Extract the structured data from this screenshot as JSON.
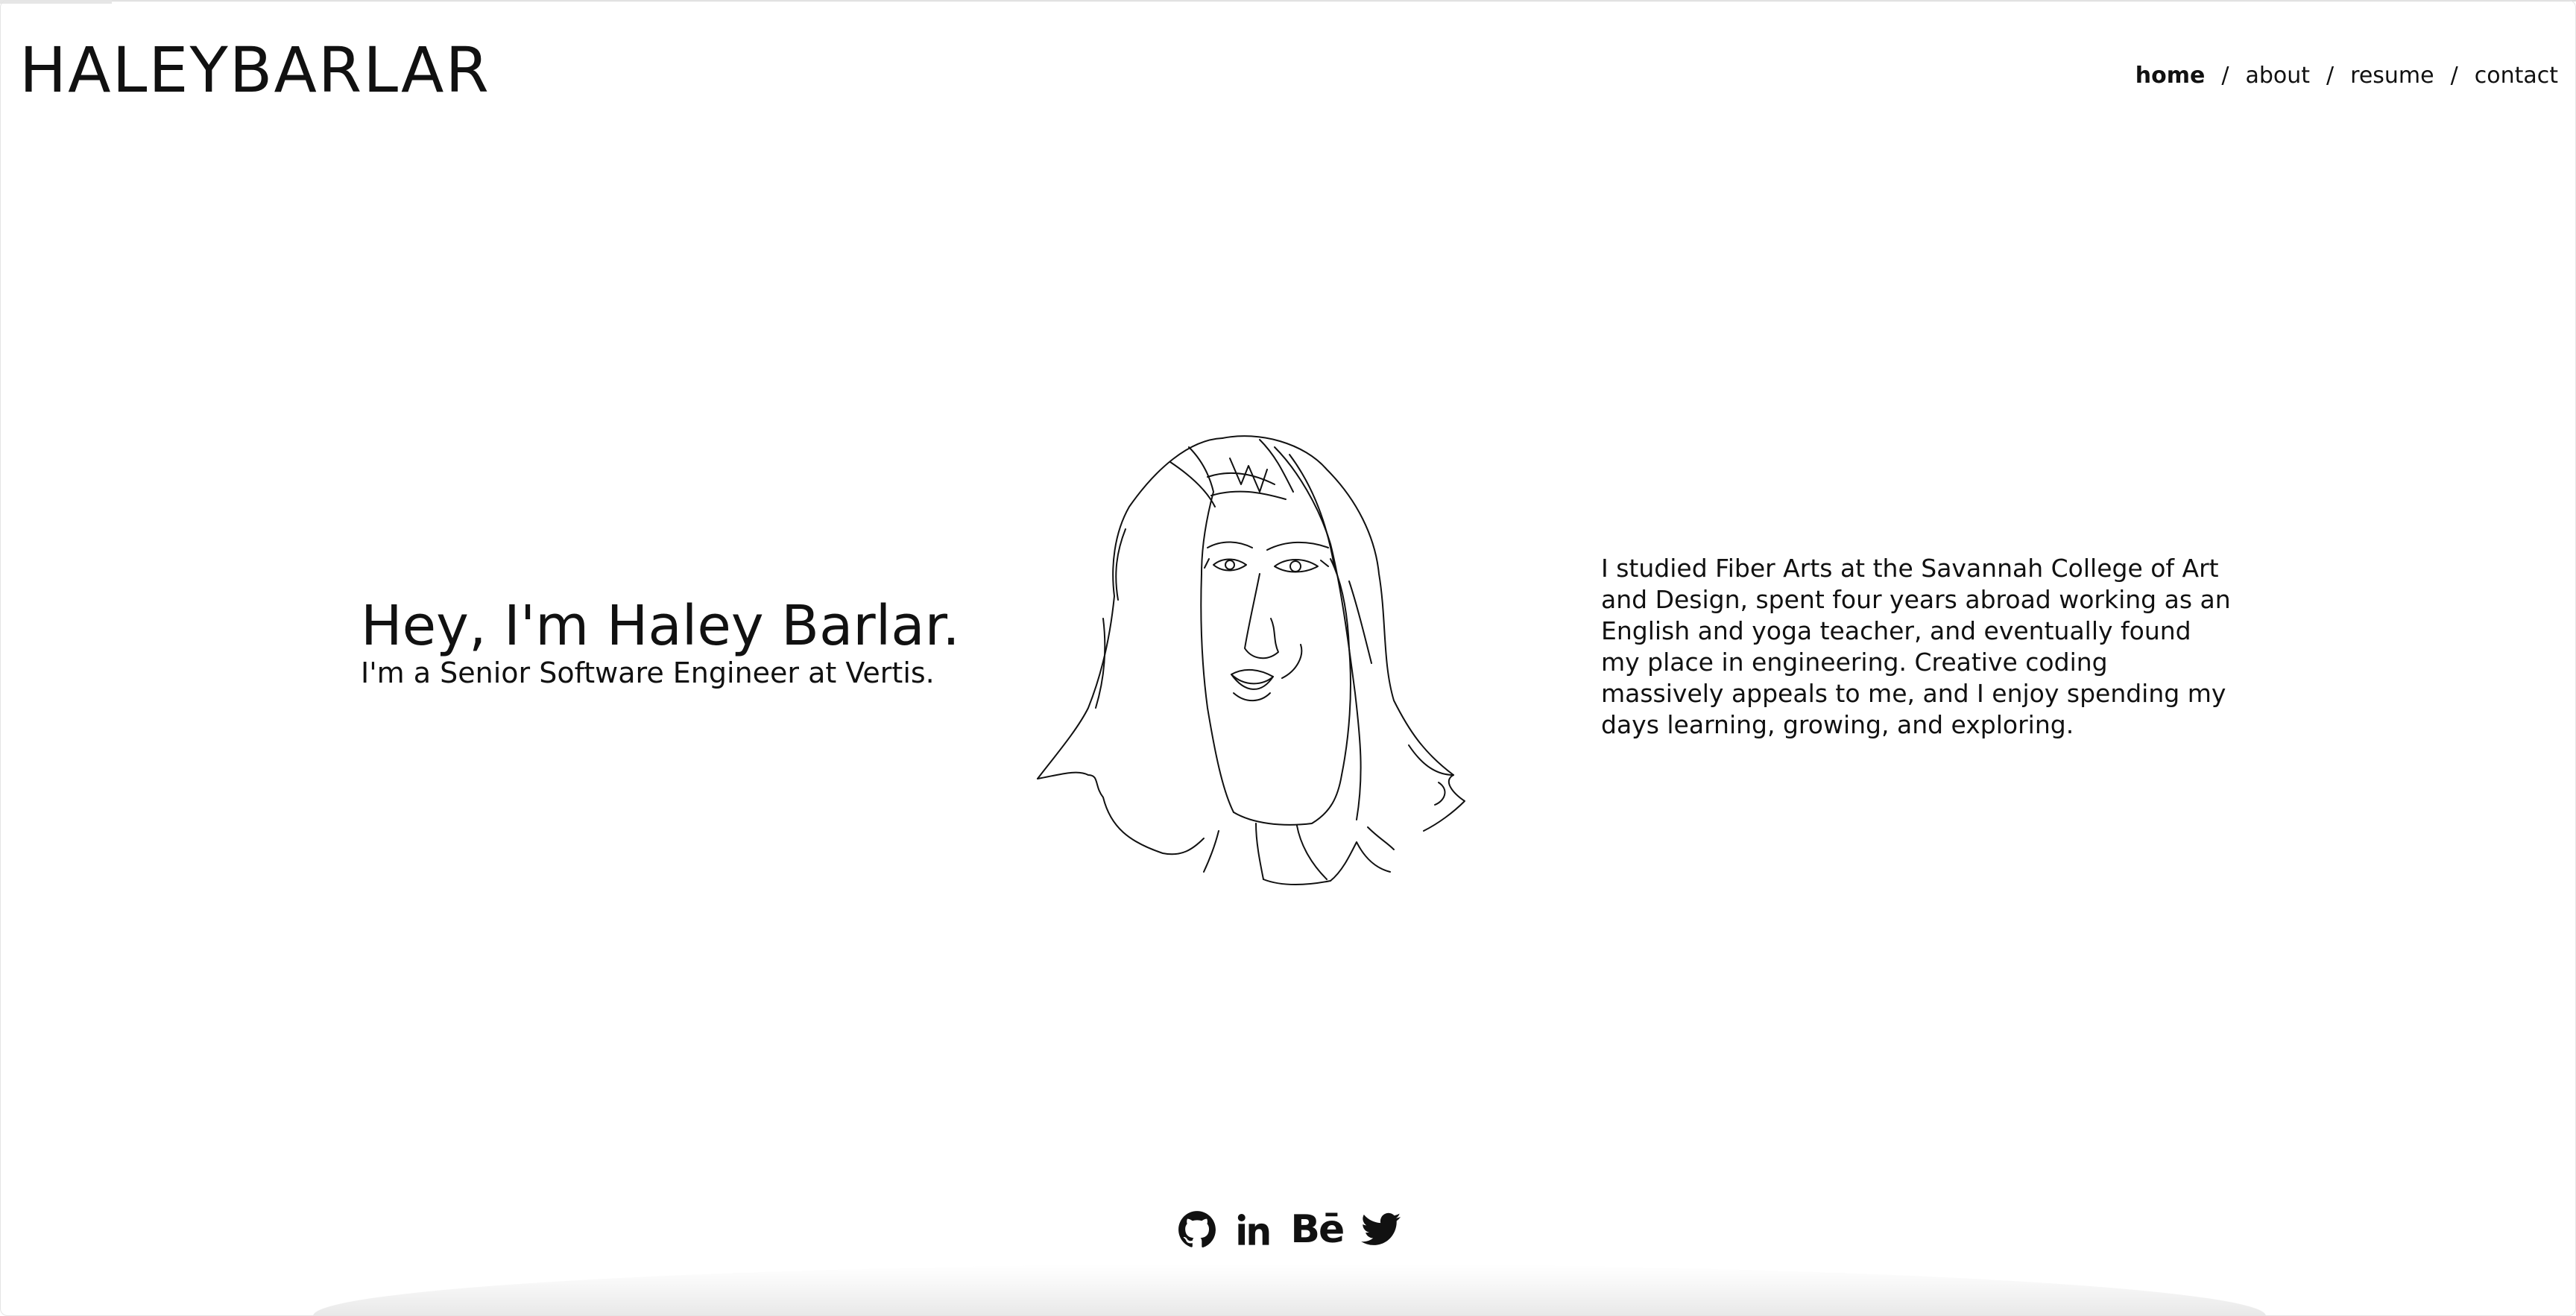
{
  "header": {
    "brand": "HALEYBARLAR",
    "nav": [
      {
        "label": "home",
        "active": true
      },
      {
        "label": "about",
        "active": false
      },
      {
        "label": "resume",
        "active": false
      },
      {
        "label": "contact",
        "active": false
      }
    ],
    "separator": "/"
  },
  "hero": {
    "title": "Hey, I'm Haley Barlar.",
    "subtitle": "I'm a Senior Software Engineer at Vertis."
  },
  "bio": {
    "text": "I studied Fiber Arts at the Savannah College of Art and Design, spent four years abroad working as an English and yoga teacher, and eventually found my place in engineering. Creative coding massively appeals to me, and I enjoy spending my days learning, growing, and exploring."
  },
  "socials": {
    "behance_label": "Bē",
    "icons": [
      "github-icon",
      "linkedin-icon",
      "behance-icon",
      "twitter-icon"
    ]
  },
  "colors": {
    "text": "#111111",
    "background": "#ffffff"
  }
}
